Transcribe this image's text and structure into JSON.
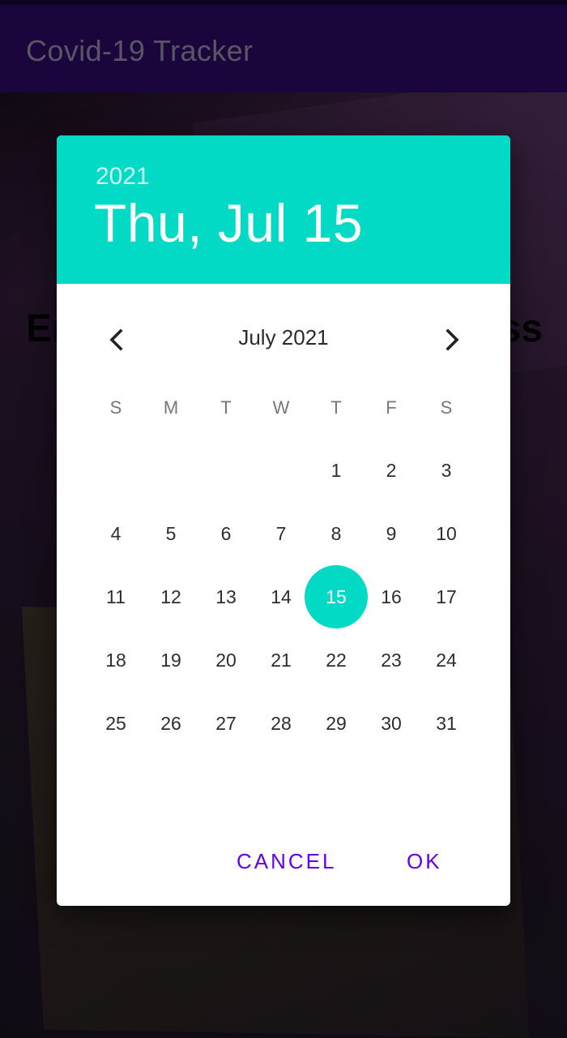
{
  "app": {
    "title": "Covid-19 Tracker",
    "background_heading_left": "Er",
    "background_heading_right": "ss"
  },
  "date_picker": {
    "selected_year": "2021",
    "selected_date_label": "Thu, Jul 15",
    "month_label": "July 2021",
    "prev_icon": "chevron-left-icon",
    "next_icon": "chevron-right-icon",
    "weekdays": [
      "S",
      "M",
      "T",
      "W",
      "T",
      "F",
      "S"
    ],
    "weeks": [
      [
        "",
        "",
        "",
        "",
        "1",
        "2",
        "3"
      ],
      [
        "4",
        "5",
        "6",
        "7",
        "8",
        "9",
        "10"
      ],
      [
        "11",
        "12",
        "13",
        "14",
        "15",
        "16",
        "17"
      ],
      [
        "18",
        "19",
        "20",
        "21",
        "22",
        "23",
        "24"
      ],
      [
        "25",
        "26",
        "27",
        "28",
        "29",
        "30",
        "31"
      ]
    ],
    "selected_day": "15",
    "cancel_label": "CANCEL",
    "ok_label": "OK"
  },
  "colors": {
    "header": "#03DAC5",
    "accent": "#6200EE",
    "app_bar": "#2A0B63"
  }
}
